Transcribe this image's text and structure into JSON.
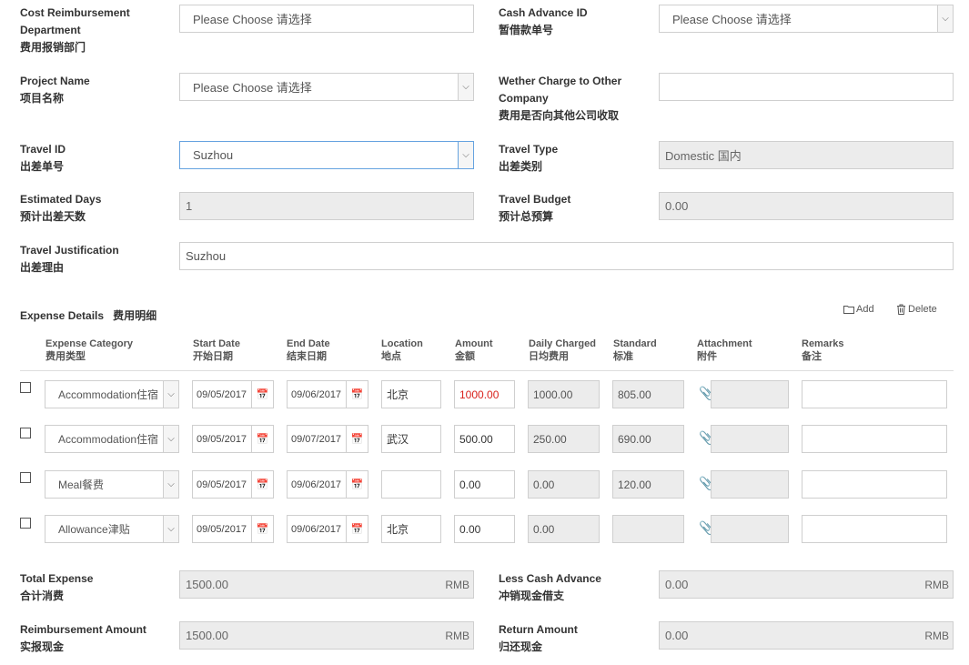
{
  "form": {
    "cost_dept": {
      "label_en_1": "Cost Reimbursement",
      "label_en_2": "Department",
      "label_cn": "费用报销部门",
      "value": "Please Choose 请选择"
    },
    "cash_advance_id": {
      "label_en": "Cash Advance ID",
      "label_cn": "暂借款单号",
      "value": "Please Choose 请选择"
    },
    "project_name": {
      "label_en": "Project Name",
      "label_cn": "项目名称",
      "value": "Please Choose 请选择"
    },
    "charge_other": {
      "label_en_1": "Wether Charge to Other",
      "label_en_2": "Company",
      "label_cn": "费用是否向其他公司收取",
      "value": ""
    },
    "travel_id": {
      "label_en": "Travel ID",
      "label_cn": "出差单号",
      "value": "Suzhou"
    },
    "travel_type": {
      "label_en": "Travel Type",
      "label_cn": "出差类别",
      "value": "Domestic 国内"
    },
    "estimated_days": {
      "label_en": "Estimated Days",
      "label_cn": "预计出差天数",
      "value": "1"
    },
    "travel_budget": {
      "label_en": "Travel Budget",
      "label_cn": "预计总预算",
      "value": "0.00"
    },
    "justification": {
      "label_en": "Travel Justification",
      "label_cn": "出差理由",
      "value": "Suzhou"
    }
  },
  "expense": {
    "title_en": "Expense Details",
    "title_cn": "费用明细",
    "add_label": "Add",
    "delete_label": "Delete",
    "columns": [
      {
        "en": "Expense Category",
        "cn": "费用类型"
      },
      {
        "en": "Start Date",
        "cn": "开始日期"
      },
      {
        "en": "End Date",
        "cn": "结束日期"
      },
      {
        "en": "Location",
        "cn": "地点"
      },
      {
        "en": "Amount",
        "cn": "金额"
      },
      {
        "en": "Daily Charged",
        "cn": "日均费用"
      },
      {
        "en": "Standard",
        "cn": "标准"
      },
      {
        "en": "Attachment",
        "cn": "附件"
      },
      {
        "en": "Remarks",
        "cn": "备注"
      }
    ],
    "rows": [
      {
        "category": "Accommodation住宿",
        "start": "09/05/2017",
        "end": "09/06/2017",
        "location": "北京",
        "amount": "1000.00",
        "daily": "1000.00",
        "standard": "805.00",
        "remarks": ""
      },
      {
        "category": "Accommodation住宿",
        "start": "09/05/2017",
        "end": "09/07/2017",
        "location": "武汉",
        "amount": "500.00",
        "daily": "250.00",
        "standard": "690.00",
        "remarks": ""
      },
      {
        "category": "Meal餐费",
        "start": "09/05/2017",
        "end": "09/06/2017",
        "location": "",
        "amount": "0.00",
        "daily": "0.00",
        "standard": "120.00",
        "remarks": ""
      },
      {
        "category": "Allowance津贴",
        "start": "09/05/2017",
        "end": "09/06/2017",
        "location": "北京",
        "amount": "0.00",
        "daily": "0.00",
        "standard": "",
        "remarks": ""
      }
    ]
  },
  "totals": {
    "total_expense": {
      "label_en": "Total Expense",
      "label_cn": "合计消费",
      "value": "1500.00",
      "unit": "RMB"
    },
    "less_cash_advance": {
      "label_en": "Less Cash Advance",
      "label_cn": "冲销现金借支",
      "value": "0.00",
      "unit": "RMB"
    },
    "reimbursement": {
      "label_en": "Reimbursement Amount",
      "label_cn": "实报现金",
      "value": "1500.00",
      "unit": "RMB"
    },
    "return_amount": {
      "label_en": "Return Amount",
      "label_cn": "归还现金",
      "value": "0.00",
      "unit": "RMB"
    }
  },
  "colors": {
    "amount_over_standard": "#d9221c",
    "focus_border": "#66a3e0",
    "readonly_bg": "#ececec"
  }
}
